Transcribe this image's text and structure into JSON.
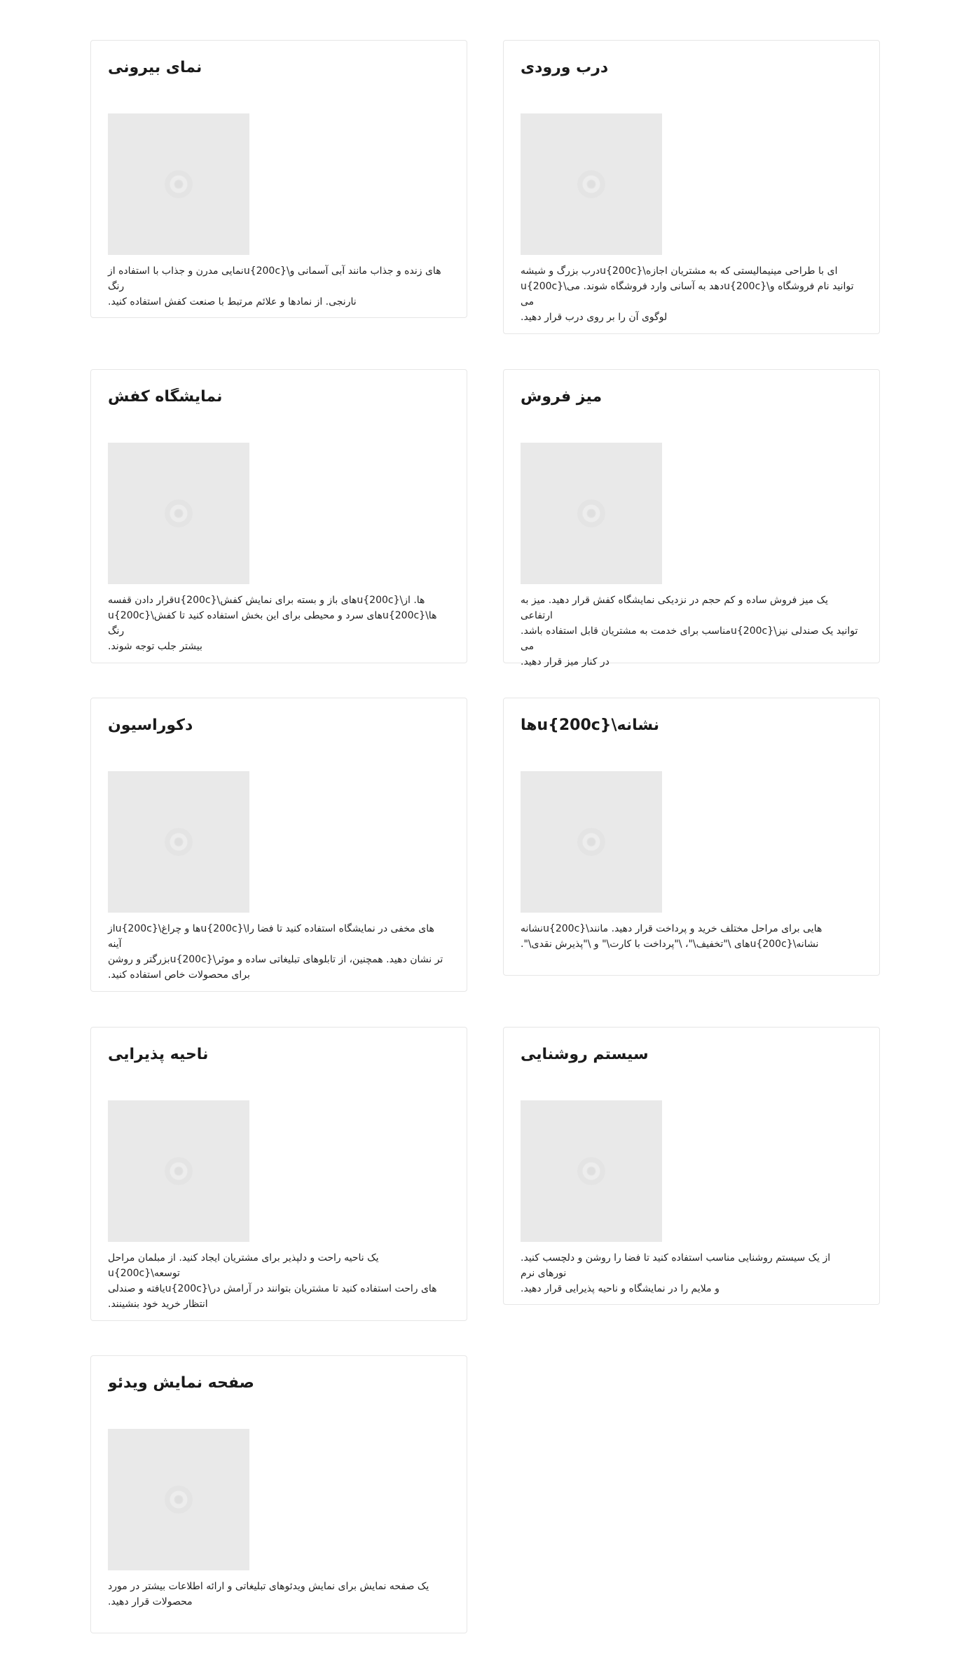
{
  "cards": [
    {
      "title": "درب ورودی",
      "description": "ای با طراحی مینیمالیستی که به مشتریان اجازه\\u{200c}درب بزرگ و شیشه\nتوانید نام فروشگاه و\\u{200c}دهد به آسانی وارد فروشگاه شوند. می\\u{200c}می\nلوگوی آن را بر روی درب قرار دهید."
    },
    {
      "title": "نمای بیرونی",
      "description": "های زنده و جذاب مانند آبی آسمانی و\\u{200c}نمایی مدرن و جذاب با استفاده از رنگ\nنارنجی. از نمادها و علائم مرتبط با صنعت کفش استفاده کنید."
    },
    {
      "title": "میز فروش",
      "description": "یک میز فروش ساده و کم حجم در نزدیکی نمایشگاه کفش قرار دهید. میز به ارتفاعی\nتوانید یک صندلی نیز\\u{200c}مناسب برای خدمت به مشتریان قابل استفاده باشد. می\nدر کنار میز قرار دهید."
    },
    {
      "title": "نمایشگاه کفش",
      "description": "ها. از\\u{200c}های باز و بسته برای نمایش کفش\\u{200c}قرار دادن قفسه\nها\\u{200c}های سرد و محیطی برای این بخش استفاده کنید تا کفش\\u{200c}رنگ\nبیشتر جلب توجه شوند."
    },
    {
      "title": "نشانه\\u{200c}ها",
      "description": "هایی برای مراحل مختلف خرید و پرداخت قرار دهید. مانند\\u{200c}نشانه\nنشانه\\u{200c}های \\\"تخفیف\\\"، \\\"پرداخت با کارت\\\" و \\\"پذیرش نقدی\\\"."
    },
    {
      "title": "دکوراسیون",
      "description": "های مخفی در نمایشگاه استفاده کنید تا فضا را\\u{200c}ها و چراغ\\u{200c}از آینه\nتر نشان دهید. همچنین، از تابلوهای تبلیغاتی ساده و موثر\\u{200c}بزرگتر و روشن\nبرای محصولات خاص استفاده کنید."
    },
    {
      "title": "سیستم روشنایی",
      "description": "از یک سیستم روشنایی مناسب استفاده کنید تا فضا را روشن و دلچسب کنید. نورهای نرم\nو ملایم را در نمایشگاه و ناحیه پذیرایی قرار دهید."
    },
    {
      "title": "ناحیه پذیرایی",
      "description": "یک ناحیه راحت و دلپذیر برای مشتریان ایجاد کنید. از مبلمان مراحل توسعه\\u{200c}\nهای راحت استفاده کنید تا مشتریان بتوانند در آرامش در\\u{200c}یافته و صندلی\nانتظار خرید خود بنشینند."
    },
    {
      "title": "صفحه نمایش ویدئو",
      "description": "یک صفحه نمایش برای نمایش ویدئوهای تبلیغاتی و ارائه اطلاعات بیشتر در مورد\nمحصولات قرار دهید."
    }
  ]
}
